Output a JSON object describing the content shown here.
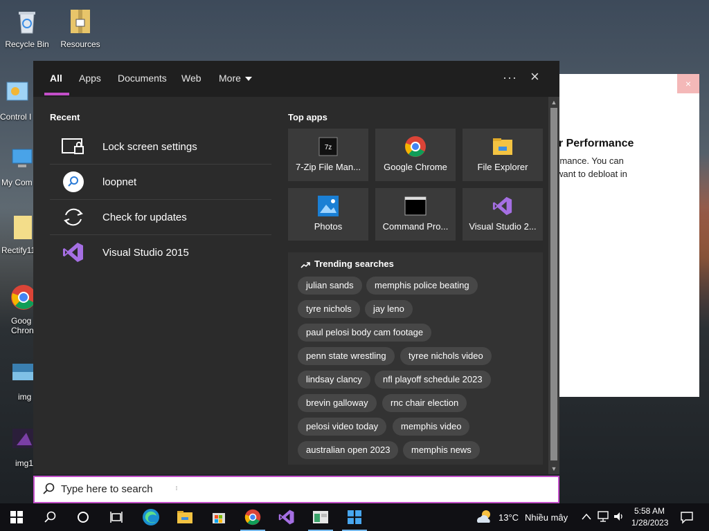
{
  "desktop": {
    "icons": [
      {
        "label": "Recycle Bin"
      },
      {
        "label": "Resources"
      },
      {
        "label": "Control I"
      },
      {
        "label": "My Com"
      },
      {
        "label": "Rectify11"
      },
      {
        "label": "Goog Chron"
      },
      {
        "label": "img"
      },
      {
        "label": "img1"
      }
    ],
    "background_window": {
      "close": "×",
      "title": "er Performance",
      "line1": "rmance. You can",
      "line2": "want to debloat in"
    }
  },
  "search_panel": {
    "tabs": [
      {
        "label": "All",
        "active": true
      },
      {
        "label": "Apps"
      },
      {
        "label": "Documents"
      },
      {
        "label": "Web"
      },
      {
        "label": "More"
      }
    ],
    "options_icon": "···",
    "close_icon": "×",
    "recent": {
      "heading": "Recent",
      "items": [
        {
          "label": "Lock screen settings",
          "icon": "lock-screen-icon"
        },
        {
          "label": "loopnet",
          "icon": "web-search-icon"
        },
        {
          "label": "Check for updates",
          "icon": "refresh-icon"
        },
        {
          "label": "Visual Studio 2015",
          "icon": "visual-studio-icon"
        }
      ]
    },
    "top_apps": {
      "heading": "Top apps",
      "items": [
        {
          "label": "7-Zip File Man...",
          "icon": "7zip-icon"
        },
        {
          "label": "Google Chrome",
          "icon": "chrome-icon"
        },
        {
          "label": "File Explorer",
          "icon": "folder-icon"
        },
        {
          "label": "Photos",
          "icon": "photos-icon"
        },
        {
          "label": "Command Pro...",
          "icon": "cmd-icon"
        },
        {
          "label": "Visual Studio 2...",
          "icon": "visual-studio-icon"
        }
      ]
    },
    "trending": {
      "heading": "Trending searches",
      "chips": [
        "julian sands",
        "memphis police beating",
        "tyre nichols",
        "jay leno",
        "paul pelosi body cam footage",
        "penn state wrestling",
        "tyree nichols video",
        "lindsay clancy",
        "nfl playoff schedule 2023",
        "brevin galloway",
        "rnc chair election",
        "pelosi video today",
        "memphis video",
        "australian open 2023",
        "memphis news"
      ]
    }
  },
  "searchbox": {
    "placeholder": "Type here to search"
  },
  "taskbar": {
    "weather_temp": "13°C",
    "weather_desc": "Nhiều mây",
    "time": "5:58 AM",
    "date": "1/28/2023"
  },
  "colors": {
    "accent": "#c34fc9",
    "panel_bg": "#2b2b2b",
    "taskbar_bg": "#101014"
  }
}
